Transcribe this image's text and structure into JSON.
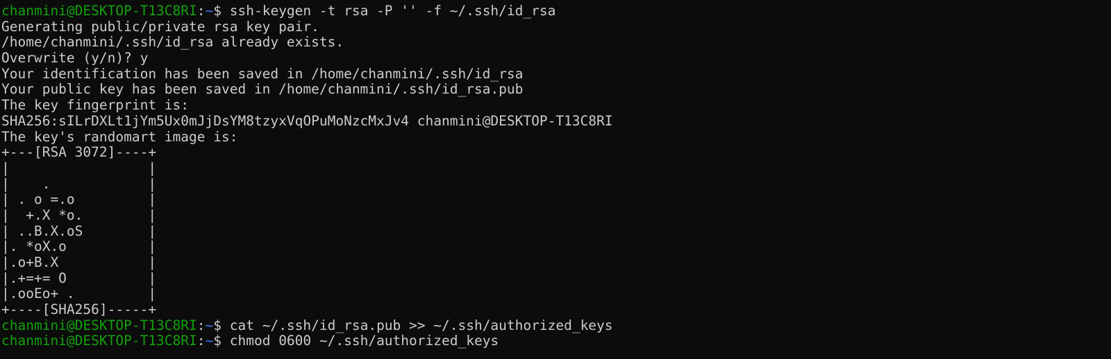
{
  "terminal": {
    "prompt": {
      "userhost": "chanmini@DESKTOP-T13C8RI",
      "sep": ":",
      "path": "~",
      "dollar": "$ "
    },
    "lines": [
      {
        "type": "prompt",
        "cmd": "ssh-keygen -t rsa -P '' -f ~/.ssh/id_rsa"
      },
      {
        "type": "output",
        "text": "Generating public/private rsa key pair."
      },
      {
        "type": "output",
        "text": "/home/chanmini/.ssh/id_rsa already exists."
      },
      {
        "type": "output",
        "text": "Overwrite (y/n)? y"
      },
      {
        "type": "output",
        "text": "Your identification has been saved in /home/chanmini/.ssh/id_rsa"
      },
      {
        "type": "output",
        "text": "Your public key has been saved in /home/chanmini/.ssh/id_rsa.pub"
      },
      {
        "type": "output",
        "text": "The key fingerprint is:"
      },
      {
        "type": "output",
        "text": "SHA256:sILrDXLt1jYm5Ux0mJjDsYM8tzyxVqOPuMoNzcMxJv4 chanmini@DESKTOP-T13C8RI"
      },
      {
        "type": "output",
        "text": "The key's randomart image is:"
      },
      {
        "type": "output",
        "text": "+---[RSA 3072]----+"
      },
      {
        "type": "output",
        "text": "|                 |"
      },
      {
        "type": "output",
        "text": "|    .            |"
      },
      {
        "type": "output",
        "text": "| . o =.o         |"
      },
      {
        "type": "output",
        "text": "|  +.X *o.        |"
      },
      {
        "type": "output",
        "text": "| ..B.X.oS        |"
      },
      {
        "type": "output",
        "text": "|. *oX.o          |"
      },
      {
        "type": "output",
        "text": "|.o+B.X           |"
      },
      {
        "type": "output",
        "text": "|.+=+= O          |"
      },
      {
        "type": "output",
        "text": "|.ooEo+ .         |"
      },
      {
        "type": "output",
        "text": "+----[SHA256]-----+"
      },
      {
        "type": "prompt",
        "cmd": "cat ~/.ssh/id_rsa.pub >> ~/.ssh/authorized_keys"
      },
      {
        "type": "prompt",
        "cmd": "chmod 0600 ~/.ssh/authorized_keys"
      }
    ]
  }
}
